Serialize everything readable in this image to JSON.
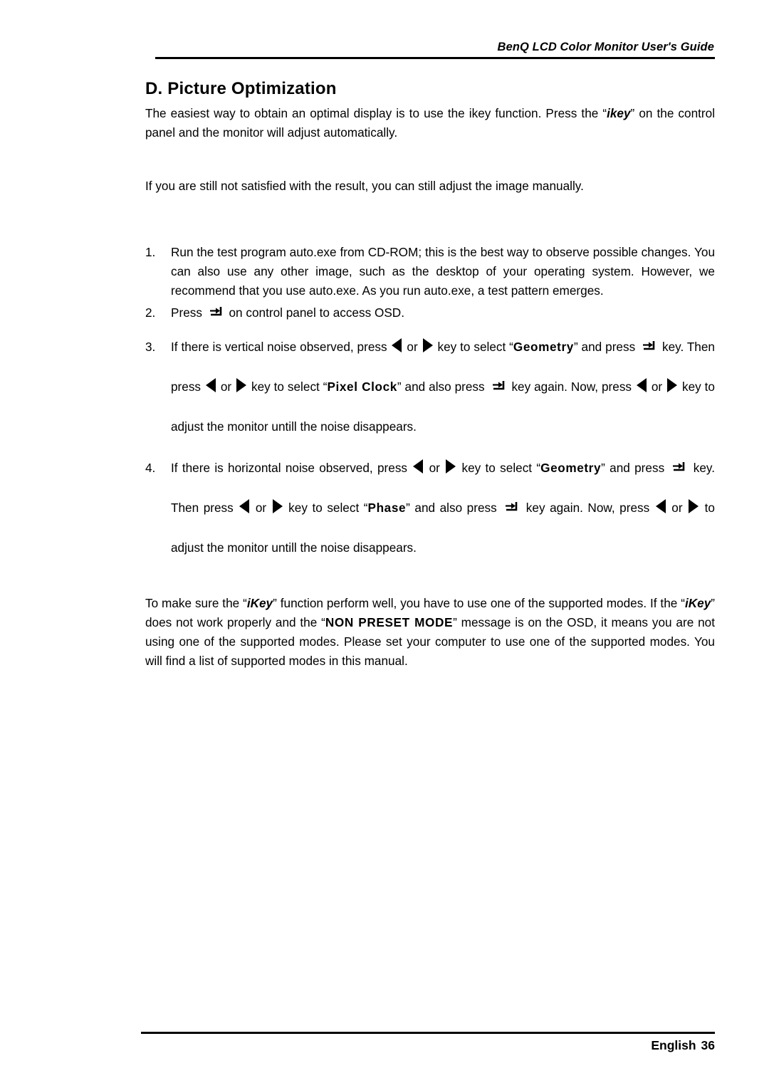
{
  "header": {
    "running_head": "BenQ LCD Color Monitor User's Guide"
  },
  "section": {
    "title": "D. Picture Optimization"
  },
  "intro": {
    "para1_part1": "The easiest way to obtain an optimal display is to use the ",
    "para1_ikey_plain": "ikey",
    "para1_part2": " function. Press the “",
    "para1_ikey_bold": "ikey",
    "para1_part3": "” on the control panel and the monitor will adjust automatically.",
    "para2": "If you are still not satisfied with the result, you can still adjust the image manually."
  },
  "steps": [
    {
      "number": "1.",
      "text": "Run the test program auto.exe from CD-ROM; this is the best way to observe possible changes. You can also use any other image, such as the desktop of your operating system. However, we recommend that you use auto.exe. As you run auto.exe, a test pattern emerges."
    },
    {
      "number": "2.",
      "text_before_icon": "Press ",
      "icon": "enter-key-icon",
      "text_after_icon": " on control panel to access OSD."
    },
    {
      "number": "3.",
      "t1": "If there is vertical noise observed, press ",
      "t2": " or ",
      "t3": " key to select “",
      "bold1": "Geometry",
      "t4": "” and press ",
      "t5": " key. Then press ",
      "t6": " or ",
      "t7": " key to select “",
      "bold2": "Pixel Clock",
      "t8": "” and also press ",
      "t9": " key again. Now, press ",
      "t10": " or ",
      "t11": " key to adjust the monitor untill the noise disappears."
    },
    {
      "number": "4.",
      "t1": "If there is horizontal noise observed, press ",
      "t2": " or ",
      "t3": " key to select “",
      "bold1": "Geometry",
      "t4": "” and press ",
      "t5": " key. Then press ",
      "t6": " or ",
      "t7": " key to select “",
      "bold2": "Phase",
      "t8": "” and also press ",
      "t9": " key again. Now, press ",
      "t10": " or ",
      "t11": " to adjust the monitor untill the noise disappears."
    }
  ],
  "closing": {
    "c1": "To make sure the “",
    "ikey1": "iKey",
    "c2": "” function perform well, you have to use one of the supported modes. If the “",
    "ikey2": "iKey",
    "c3": "” does not work properly and the “",
    "nonpreset": "NON PRESET MODE",
    "c4": "” message is on the OSD, it means you are not using one of the supported modes. Please set your computer to use one of the supported modes. You will find a list of supported modes in this manual."
  },
  "footer": {
    "language": "English",
    "page_number": "36"
  },
  "icons": {
    "enter_key": "enter-key-icon",
    "left_arrow": "left-arrow-icon",
    "right_arrow": "right-arrow-icon"
  }
}
